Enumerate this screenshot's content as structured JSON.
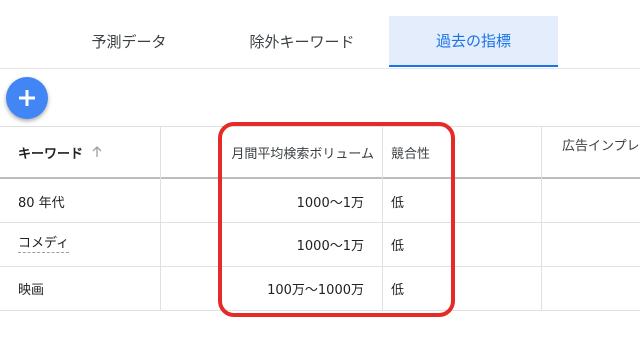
{
  "tabs": [
    {
      "label": "予測データ"
    },
    {
      "label": "除外キーワード"
    },
    {
      "label": "過去の指標"
    }
  ],
  "table": {
    "headers": {
      "keyword": "キーワード",
      "volume": "月間平均検索ボリューム",
      "competition": "競合性",
      "impressions": "広告インプレ"
    },
    "rows": [
      {
        "keyword": "80 年代",
        "volume": "1000～1万",
        "competition": "低"
      },
      {
        "keyword": "コメディ",
        "volume": "1000～1万",
        "competition": "低"
      },
      {
        "keyword": "映画",
        "volume": "100万～1000万",
        "competition": "低"
      }
    ]
  },
  "colors": {
    "accent": "#1a73e8",
    "fab": "#4285f4",
    "highlight": "#e52b27",
    "active_tab_bg": "#e3edfb"
  },
  "icons": {
    "fab": "plus-icon",
    "sort": "arrow-up-icon"
  }
}
